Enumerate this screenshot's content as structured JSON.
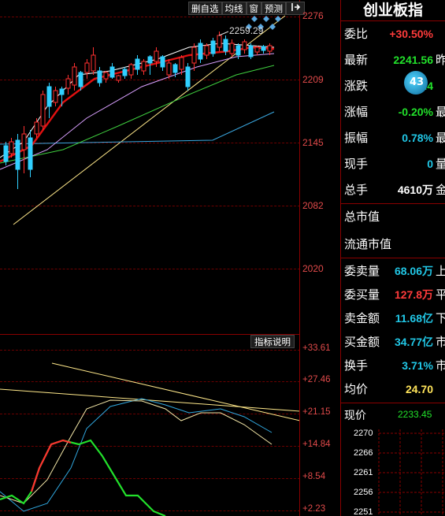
{
  "toolbar": {
    "items": [
      "删自选",
      "均线",
      "窗",
      "预测"
    ],
    "pin_icon": "pin-exit-icon"
  },
  "main_chart": {
    "y_ticks": [
      "2276",
      "2209",
      "2145",
      "2082",
      "2020"
    ],
    "annotation": "2259.29"
  },
  "indicator": {
    "button": "指标说明",
    "y_ticks": [
      "+33.61",
      "+27.46",
      "+21.15",
      "+14.84",
      "+8.54",
      "+2.23"
    ]
  },
  "quote": {
    "title": "创业板指",
    "rows": [
      {
        "label": "委比",
        "value": "+30.50%",
        "color": "#ff3b3b",
        "cut": ""
      },
      {
        "label": "最新",
        "value": "2241.56",
        "color": "#22e02b",
        "cut": "昨"
      },
      {
        "label": "涨跌",
        "value": "-4.4",
        "color": "#22e02b",
        "cut": ""
      },
      {
        "label": "涨幅",
        "value": "-0.20%",
        "color": "#22e02b",
        "cut": "最"
      },
      {
        "label": "振幅",
        "value": "0.78%",
        "color": "#21c7e6",
        "cut": "最"
      },
      {
        "label": "现手",
        "value": "0",
        "color": "#21c7e6",
        "cut": "量"
      },
      {
        "label": "总手",
        "value": "4610万",
        "color": "#ffffff",
        "cut": "金"
      }
    ],
    "badge": "43",
    "extra": [
      {
        "label": "总市值"
      },
      {
        "label": "流通市值"
      }
    ],
    "rows2": [
      {
        "label": "委卖量",
        "value": "68.06万",
        "color": "#21c7e6",
        "cut": "上"
      },
      {
        "label": "委买量",
        "value": "127.8万",
        "color": "#ff3b3b",
        "cut": "平"
      },
      {
        "label": "卖金额",
        "value": "11.68亿",
        "color": "#21c7e6",
        "cut": "下"
      },
      {
        "label": "买金额",
        "value": "34.77亿",
        "color": "#21c7e6",
        "cut": "市"
      },
      {
        "label": "换手",
        "value": "3.71%",
        "color": "#21c7e6",
        "cut": "市"
      },
      {
        "label": "均价",
        "value": "24.70",
        "color": "#ffe45a",
        "cut": ""
      }
    ],
    "current_label": "现价",
    "current_value": "2233.45",
    "mini_ticks": [
      "2270",
      "2266",
      "2261",
      "2256",
      "2251"
    ]
  }
}
